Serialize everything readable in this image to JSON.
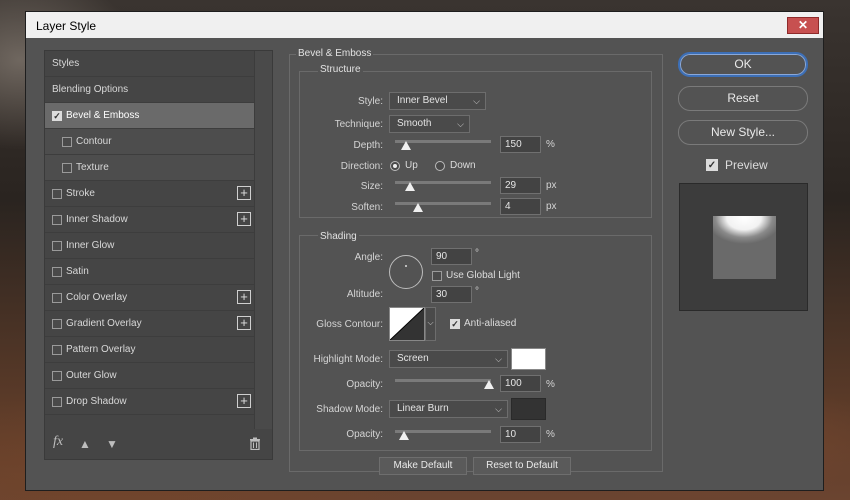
{
  "window": {
    "title": "Layer Style",
    "close_glyph": "✕"
  },
  "style_list": {
    "items": [
      {
        "label": "Styles",
        "kind": "head",
        "checked": null,
        "plus": false,
        "selected": false
      },
      {
        "label": "Blending Options",
        "kind": "head",
        "checked": null,
        "plus": false,
        "selected": false
      },
      {
        "label": "Bevel & Emboss",
        "kind": "item",
        "checked": true,
        "plus": false,
        "selected": true
      },
      {
        "label": "Contour",
        "kind": "sub",
        "checked": false,
        "plus": false,
        "selected": false
      },
      {
        "label": "Texture",
        "kind": "sub",
        "checked": false,
        "plus": false,
        "selected": false
      },
      {
        "label": "Stroke",
        "kind": "item",
        "checked": false,
        "plus": true,
        "selected": false
      },
      {
        "label": "Inner Shadow",
        "kind": "item",
        "checked": false,
        "plus": true,
        "selected": false
      },
      {
        "label": "Inner Glow",
        "kind": "item",
        "checked": false,
        "plus": false,
        "selected": false
      },
      {
        "label": "Satin",
        "kind": "item",
        "checked": false,
        "plus": false,
        "selected": false
      },
      {
        "label": "Color Overlay",
        "kind": "item",
        "checked": false,
        "plus": true,
        "selected": false
      },
      {
        "label": "Gradient Overlay",
        "kind": "item",
        "checked": false,
        "plus": true,
        "selected": false
      },
      {
        "label": "Pattern Overlay",
        "kind": "item",
        "checked": false,
        "plus": false,
        "selected": false
      },
      {
        "label": "Outer Glow",
        "kind": "item",
        "checked": false,
        "plus": false,
        "selected": false
      },
      {
        "label": "Drop Shadow",
        "kind": "item",
        "checked": false,
        "plus": true,
        "selected": false
      }
    ],
    "footer": {
      "fx_label": "fx"
    }
  },
  "bevel": {
    "section_title": "Bevel & Emboss",
    "structure_title": "Structure",
    "style_label": "Style:",
    "style_value": "Inner Bevel",
    "technique_label": "Technique:",
    "technique_value": "Smooth",
    "depth_label": "Depth:",
    "depth_value": "150",
    "depth_unit": "%",
    "direction_label": "Direction:",
    "direction_up": "Up",
    "direction_down": "Down",
    "direction_selected": "Up",
    "size_label": "Size:",
    "size_value": "29",
    "size_unit": "px",
    "soften_label": "Soften:",
    "soften_value": "4",
    "soften_unit": "px"
  },
  "shading": {
    "title": "Shading",
    "angle_label": "Angle:",
    "angle_value": "90",
    "angle_unit": "°",
    "global_light_label": "Use Global Light",
    "global_light_checked": false,
    "altitude_label": "Altitude:",
    "altitude_value": "30",
    "altitude_unit": "°",
    "gloss_label": "Gloss Contour:",
    "anti_aliased_label": "Anti-aliased",
    "anti_aliased_checked": true,
    "highlight_mode_label": "Highlight Mode:",
    "highlight_mode_value": "Screen",
    "highlight_color": "#ffffff",
    "highlight_opacity_label": "Opacity:",
    "highlight_opacity_value": "100",
    "highlight_opacity_unit": "%",
    "shadow_mode_label": "Shadow Mode:",
    "shadow_mode_value": "Linear Burn",
    "shadow_color": "#333333",
    "shadow_opacity_label": "Opacity:",
    "shadow_opacity_value": "10",
    "shadow_opacity_unit": "%"
  },
  "buttons": {
    "make_default": "Make Default",
    "reset_default": "Reset to Default",
    "ok": "OK",
    "reset": "Reset",
    "new_style": "New Style...",
    "preview_label": "Preview",
    "preview_checked": true
  },
  "colors": {
    "accent": "#3c6fb7",
    "panel": "#535353",
    "list_bg": "#454545"
  }
}
